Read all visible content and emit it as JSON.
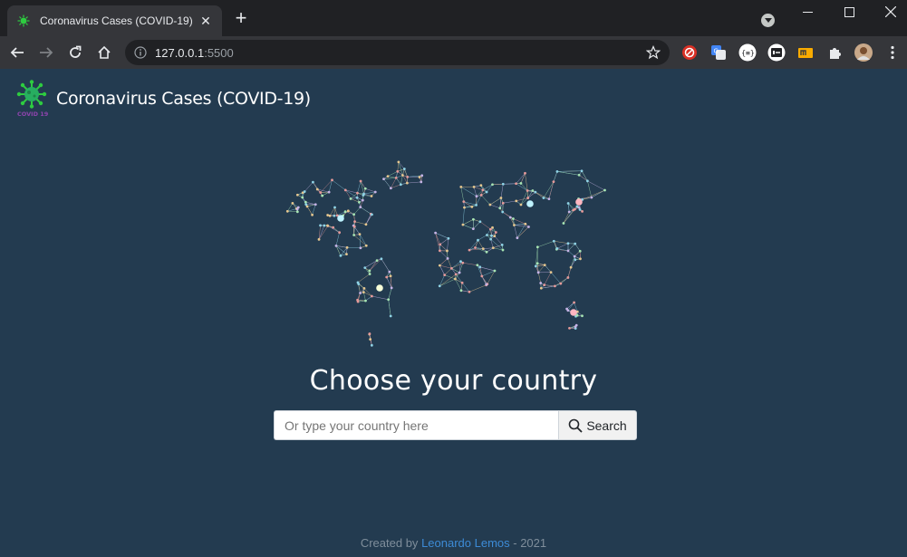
{
  "browser": {
    "tab_title": "Coronavirus Cases (COVID-19)",
    "url_host": "127.0.0.1",
    "url_port": ":5500"
  },
  "header": {
    "logo_text": "COVID 19",
    "title": "Coronavirus Cases (COVID-19)"
  },
  "hero": {
    "heading": "Choose your country"
  },
  "search": {
    "placeholder": "Or type your country here",
    "button_label": "Search"
  },
  "footer": {
    "prefix": "Created by",
    "author": "Leonardo Lemos",
    "suffix": "- 2021"
  },
  "colors": {
    "page_bg": "#233b50",
    "accent_link": "#3d8bd6",
    "logo_green": "#2ecc40"
  }
}
